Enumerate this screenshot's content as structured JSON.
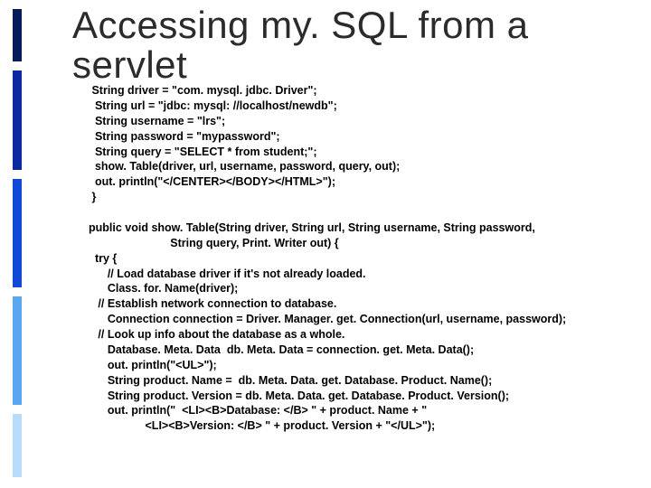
{
  "title_line1": "Accessing my. SQL from a",
  "title_line2": "servlet",
  "code_lines": [
    " String driver = \"com. mysql. jdbc. Driver\";",
    "  String url = \"jdbc: mysql: //localhost/newdb\";",
    "  String username = \"lrs\";",
    "  String password = \"mypassword\";",
    "  String query = \"SELECT * from student;\";",
    "  show. Table(driver, url, username, password, query, out);",
    "  out. println(\"</CENTER></BODY></HTML>\");",
    " }",
    "",
    "public void show. Table(String driver, String url, String username, String password,",
    "                          String query, Print. Writer out) {",
    "  try {",
    "      // Load database driver if it's not already loaded.",
    "      Class. for. Name(driver);",
    "   // Establish network connection to database.",
    "      Connection connection = Driver. Manager. get. Connection(url, username, password);",
    "   // Look up info about the database as a whole.",
    "      Database. Meta. Data  db. Meta. Data = connection. get. Meta. Data();",
    "      out. println(\"<UL>\");",
    "      String product. Name =  db. Meta. Data. get. Database. Product. Name();",
    "      String product. Version = db. Meta. Data. get. Database. Product. Version();",
    "      out. println(\"  <LI><B>Database: </B> \" + product. Name + \"",
    "                  <LI><B>Version: </B> \" + product. Version + \"</UL>\");"
  ]
}
